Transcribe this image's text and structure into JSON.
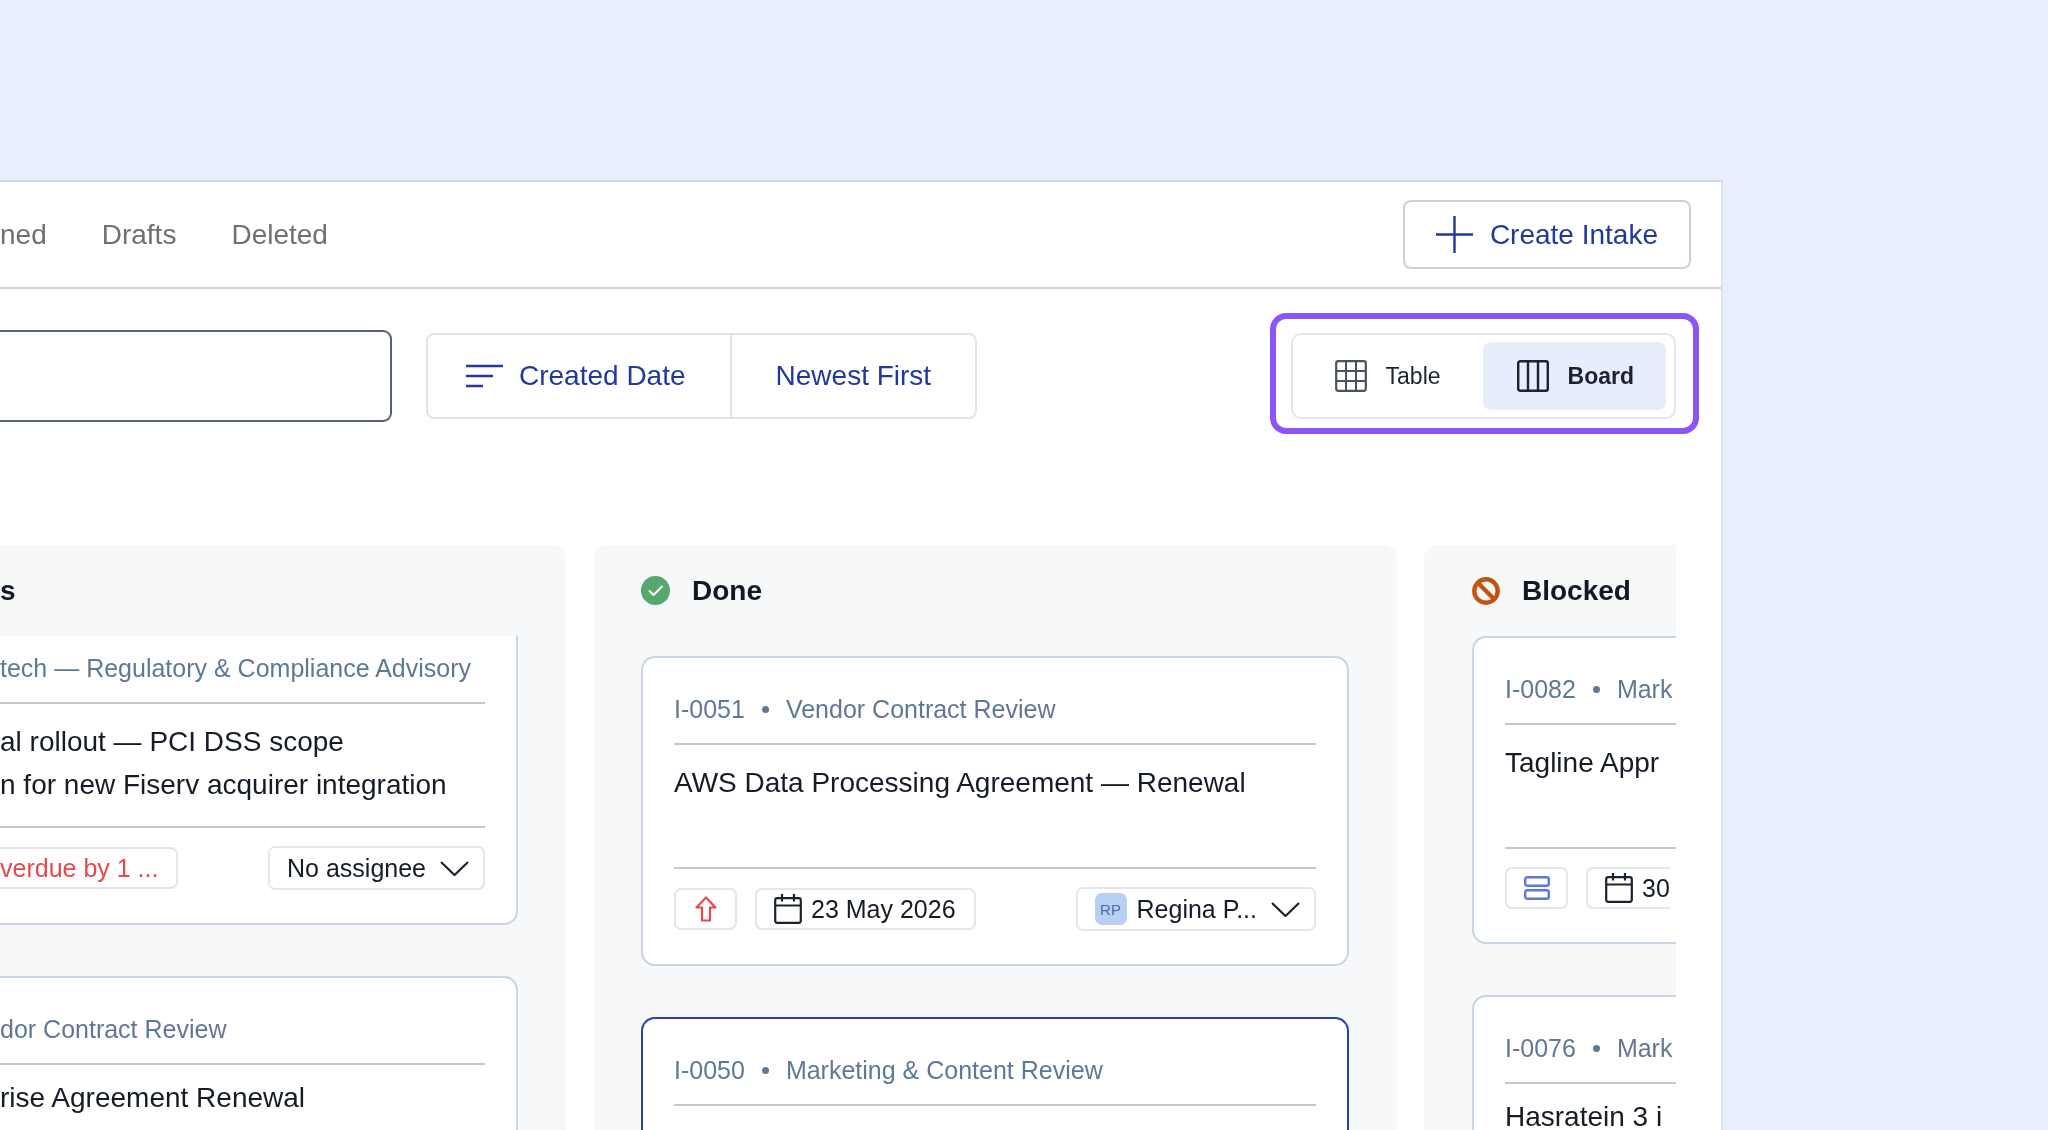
{
  "tabs": [
    {
      "label": "ned",
      "selected": false
    },
    {
      "label": "Drafts",
      "selected": false
    },
    {
      "label": "Deleted",
      "selected": false
    }
  ],
  "create_button": {
    "label": "Create Intake"
  },
  "sort": {
    "field": "Created Date",
    "order": "Newest First"
  },
  "view_switch": {
    "highlighted": true,
    "options": [
      {
        "label": "Table",
        "kind": "table",
        "selected": false
      },
      {
        "label": "Board",
        "kind": "board",
        "selected": true
      }
    ]
  },
  "columns": [
    {
      "title": "s",
      "cards": [
        {
          "category": "tech — Regulatory & Compliance Advisory",
          "title": "al rollout — PCI DSS scope\nn for new Fiserv acquirer integration",
          "due": {
            "text": "verdue by 1 ...",
            "overdue": true
          },
          "assignee": {
            "name": "No assignee"
          },
          "selected": false
        },
        {
          "category": "dor Contract Review",
          "title": "rise Agreement Renewal",
          "selected": false
        }
      ]
    },
    {
      "title": "Done",
      "kind": "done",
      "cards": [
        {
          "id": "I-0051",
          "category": "Vendor Contract Review",
          "title": "AWS Data Processing Agreement — Renewal",
          "priority": {
            "kind": "high"
          },
          "due": {
            "text": "23 May 2026",
            "overdue": false
          },
          "assignee": {
            "initials": "RP",
            "name": "Regina P..."
          },
          "selected": false
        },
        {
          "id": "I-0050",
          "category": "Marketing & Content Review",
          "selected": true
        }
      ]
    },
    {
      "title": "Blocked",
      "kind": "blocked",
      "cards": [
        {
          "id": "I-0082",
          "category": "Mark",
          "title": "Tagline Appr",
          "priority": {
            "kind": "medium"
          },
          "due": {
            "text": "30",
            "overdue": false
          },
          "selected": false
        },
        {
          "id": "I-0076",
          "category": "Mark",
          "title": "Hasratein 3 i",
          "selected": false
        }
      ]
    }
  ]
}
